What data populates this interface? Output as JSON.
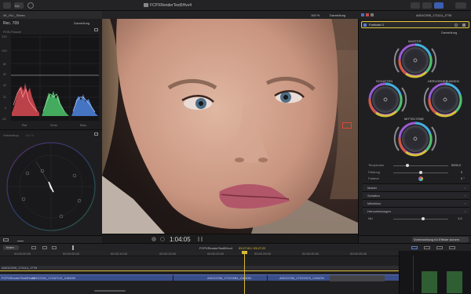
{
  "toolbar": {
    "library_label": "Bib",
    "app_label": "FCPXRenderTest5Hvv4",
    "zoom": "100 %",
    "view_menu": "Darstellung",
    "clip_name": "A001C009_171114_J77N"
  },
  "viewer": {
    "timecode": "1:04:05"
  },
  "left": {
    "library_title": "4K_HLL_Stereo",
    "rec_label": "Rec. 709",
    "view_menu": "Darstellung",
    "rgb_parade_label": "RGB-Parade",
    "parade_ticks": [
      "120",
      "100",
      "80",
      "60",
      "40",
      "20",
      "0",
      "-20"
    ],
    "parade_channels": [
      "Rot",
      "Grün",
      "Blau"
    ],
    "vectorscope_label": "Vektorskop",
    "vectorscope_sub": "100 %"
  },
  "inspector": {
    "effect_name": "Farbtafel 2",
    "view_menu": "Darstellung",
    "wheels": {
      "master": "MASTER",
      "shadows": "SCHATTEN",
      "highlights": "HERVORHEBUNGEN",
      "midtones": "MITTELTÖNE"
    },
    "params": {
      "temperature_label": "Temperatur",
      "temperature_value": "5000,0",
      "tint_label": "Färbung",
      "tint_value": "0",
      "hue_label": "Farbton",
      "hue_value": "0 °"
    },
    "sections": [
      "Master",
      "Schatten",
      "Mitteltöne",
      "Hervorhebungen"
    ],
    "mix_label": "Mix",
    "mix_value": "1,0",
    "save_button": "Voreinstellung für Effekte sichern"
  },
  "timeline": {
    "index_label": "Index",
    "project_name": "FCPXRenderTest5Hvv4",
    "timecode_display": "03:27:00 / 03:27:23",
    "ruler": [
      "00:00:00:00",
      "00:00:05:00",
      "00:00:10:00",
      "00:00:15:00",
      "00:00:20:00",
      "00:00:25:00",
      "00:00:30:00",
      "00:00:35:00"
    ],
    "connected_clip": "A001C009_171114_J77N",
    "clips": [
      "A001C042_171027LE_CANON",
      "A001C038_171013B4_CANON",
      "A001C036_171013CS_CANON"
    ],
    "track_label": "FCPXRenderTest5Hvv4"
  },
  "colors": {
    "accent_yellow": "#e5c93a",
    "playhead": "#d7b93a",
    "clip_blue": "#3a4e8a",
    "blue_selected": "#2b6bd6"
  }
}
